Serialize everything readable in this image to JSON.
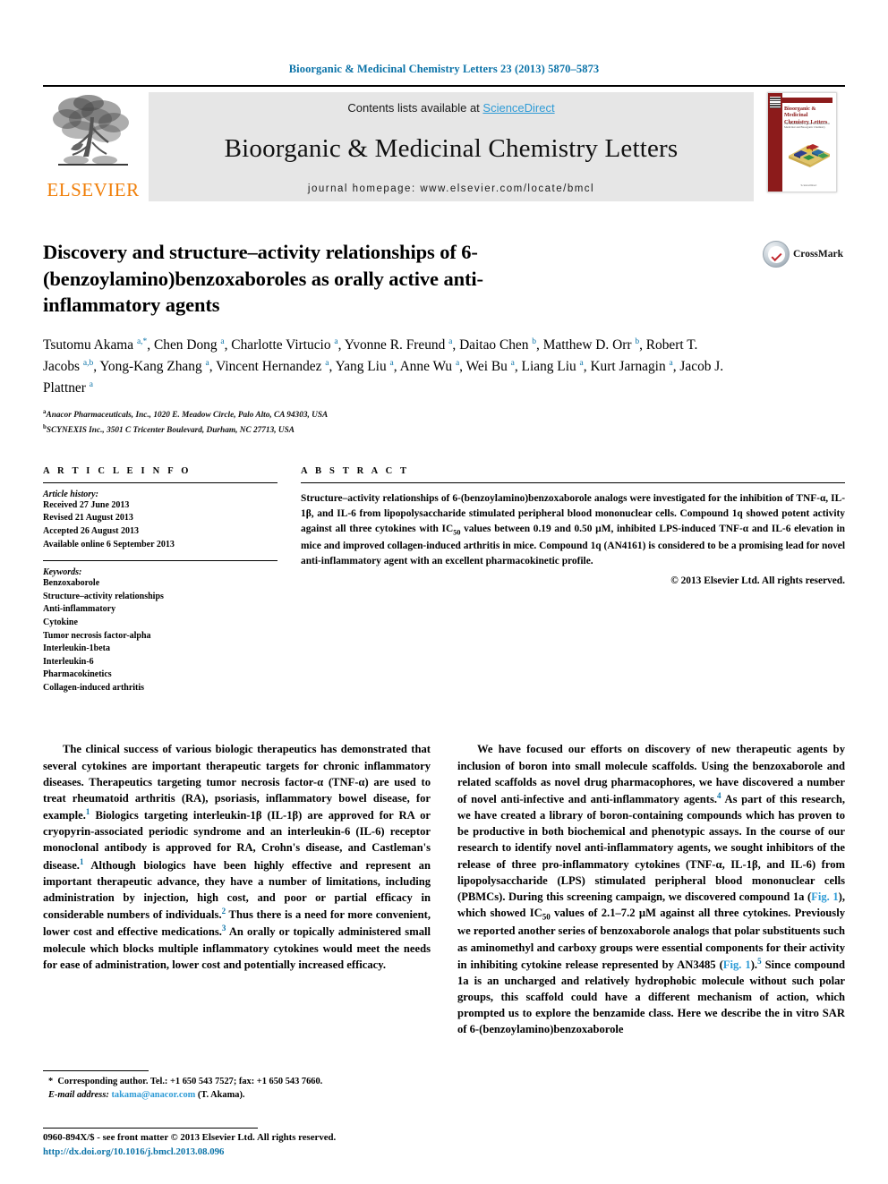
{
  "running_head": "Bioorganic & Medicinal Chemistry Letters 23 (2013) 5870–5873",
  "masthead": {
    "publisher_name": "ELSEVIER",
    "contents_prefix": "Contents lists available at ",
    "contents_link": "ScienceDirect",
    "journal_title": "Bioorganic & Medicinal Chemistry Letters",
    "homepage": "journal homepage: www.elsevier.com/locate/bmcl",
    "cover": {
      "title": "Bioorganic & Medicinal Chemistry Letters",
      "subtitle": "The International Journal for Research in Medicinal and Bioorganic Chemistry",
      "footer": "ScienceDirect"
    }
  },
  "article": {
    "title": "Discovery and structure–activity relationships of 6-(benzoylamino)benzoxaboroles as orally active anti-inflammatory agents",
    "crossmark_label": "CrossMark",
    "authors_html": "Tsutomu Akama <sup class=\"aff-mark\">a,*</sup>, Chen Dong <sup class=\"aff-mark\">a</sup>, Charlotte Virtucio <sup class=\"aff-mark\">a</sup>, Yvonne R. Freund <sup class=\"aff-mark\">a</sup>, Daitao Chen <sup class=\"aff-mark\">b</sup>, Matthew D. Orr <sup class=\"aff-mark\">b</sup>, Robert T. Jacobs <sup class=\"aff-mark\">a,b</sup>, Yong-Kang Zhang <sup class=\"aff-mark\">a</sup>, Vincent Hernandez <sup class=\"aff-mark\">a</sup>, Yang Liu <sup class=\"aff-mark\">a</sup>, Anne Wu <sup class=\"aff-mark\">a</sup>, Wei Bu <sup class=\"aff-mark\">a</sup>, Liang Liu <sup class=\"aff-mark\">a</sup>, Kurt Jarnagin <sup class=\"aff-mark\">a</sup>, Jacob J. Plattner <sup class=\"aff-mark\">a</sup>",
    "affiliations": [
      {
        "mark": "a",
        "text": "Anacor Pharmaceuticals, Inc., 1020 E. Meadow Circle, Palo Alto, CA 94303, USA"
      },
      {
        "mark": "b",
        "text": "SCYNEXIS Inc., 3501 C Tricenter Boulevard, Durham, NC 27713, USA"
      }
    ]
  },
  "article_info": {
    "heading": "A R T I C L E    I N F O",
    "history_title": "Article history:",
    "history": [
      "Received 27 June 2013",
      "Revised 21 August 2013",
      "Accepted 26 August 2013",
      "Available online 6 September 2013"
    ],
    "keywords_title": "Keywords:",
    "keywords": [
      "Benzoxaborole",
      "Structure–activity relationships",
      "Anti-inflammatory",
      "Cytokine",
      "Tumor necrosis factor-alpha",
      "Interleukin-1beta",
      "Interleukin-6",
      "Pharmacokinetics",
      "Collagen-induced arthritis"
    ]
  },
  "abstract": {
    "heading": "A B S T R A C T",
    "body_html": "Structure–activity relationships of 6-(benzoylamino)benzoxaborole analogs were investigated for the inhibition of TNF-&alpha;, IL-1&beta;, and IL-6 from lipopolysaccharide stimulated peripheral blood mononuclear cells. Compound <b>1q</b> showed potent activity against all three cytokines with IC<sub>50</sub> values between 0.19 and 0.50 &micro;M, inhibited LPS-induced TNF-&alpha; and IL-6 elevation in mice and improved collagen-induced arthritis in mice. Compound <b>1q</b> (AN4161) is considered to be a promising lead for novel anti-inflammatory agent with an excellent pharmacokinetic profile.",
    "copyright": "© 2013 Elsevier Ltd. All rights reserved."
  },
  "body": {
    "left_column_html": "The clinical success of various biologic therapeutics has demonstrated that several cytokines are important therapeutic targets for chronic inflammatory diseases. Therapeutics targeting tumor necrosis factor-&alpha; (TNF-&alpha;) are used to treat rheumatoid arthritis (RA), psoriasis, inflammatory bowel disease, for example.<sup class=\"ref\">1</sup> Biologics targeting interleukin-1&beta; (IL-1&beta;) are approved for RA or cryopyrin-associated periodic syndrome and an interleukin-6 (IL-6) receptor monoclonal antibody is approved for RA, Crohn's disease, and Castleman's disease.<sup class=\"ref\">1</sup> Although biologics have been highly effective and represent an important therapeutic advance, they have a number of limitations, including administration by injection, high cost, and poor or partial efficacy in considerable numbers of individuals.<sup class=\"ref\">2</sup> Thus there is a need for more convenient, lower cost and effective medications.<sup class=\"ref\">3</sup> An orally or topically administered small molecule which blocks multiple inflammatory cytokines would meet the needs for ease of administration, lower cost and potentially increased efficacy.",
    "right_column_html": "We have focused our efforts on discovery of new therapeutic agents by inclusion of boron into small molecule scaffolds. Using the benzoxaborole and related scaffolds as novel drug pharmacophores, we have discovered a number of novel anti-infective and anti-inflammatory agents.<sup class=\"ref\">4</sup> As part of this research, we have created a library of boron-containing compounds which has proven to be productive in both biochemical and phenotypic assays. In the course of our research to identify novel anti-inflammatory agents, we sought inhibitors of the release of three pro-inflammatory cytokines (TNF-&alpha;, IL-1&beta;, and IL-6) from lipopolysaccharide (LPS) stimulated peripheral blood mononuclear cells (PBMCs). During this screening campaign, we discovered compound <b>1a</b> (<span class=\"flink\">Fig. 1</span>), which showed IC<sub>50</sub> values of 2.1–7.2 &micro;M against all three cytokines. Previously we reported another series of benzoxaborole analogs that polar substituents such as aminomethyl and carboxy groups were essential components for their activity in inhibiting cytokine release represented by AN3485 (<span class=\"flink\">Fig. 1</span>).<sup class=\"ref\">5</sup> Since compound <b>1a</b> is an uncharged and relatively hydrophobic molecule without such polar groups, this scaffold could have a different mechanism of action, which prompted us to explore the benzamide class. Here we describe the in vitro SAR of 6-(benzoylamino)benzoxaborole"
  },
  "footnote": {
    "line1_html": "<b>*</b>&nbsp; Corresponding author. Tel.: +1 650 543 7527; fax: +1 650 543 7660.",
    "line2_html": "<span class=\"fn-italic\">E-mail address:</span> <span class=\"email\">takama@anacor.com</span> (T. Akama)."
  },
  "footer": {
    "front_matter": "0960-894X/$ - see front matter © 2013 Elsevier Ltd. All rights reserved.",
    "doi": "http://dx.doi.org/10.1016/j.bmcl.2013.08.096"
  },
  "colors": {
    "link_blue": "#2e9bd6",
    "head_blue": "#0b73a8",
    "elsevier_orange": "#f07f09",
    "cover_red": "#8c1b1b"
  }
}
